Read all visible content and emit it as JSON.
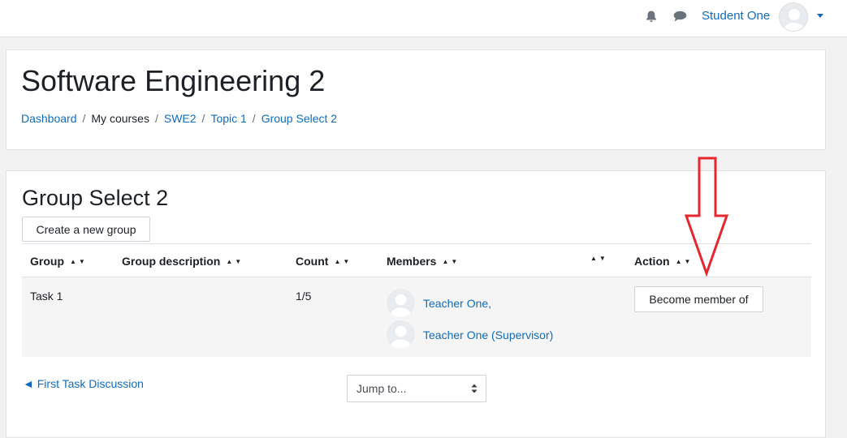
{
  "header": {
    "user_name": "Student One",
    "icons": [
      "bell-icon",
      "chat-icon",
      "avatar",
      "chevron-down-icon"
    ]
  },
  "course": {
    "title": "Software Engineering 2",
    "breadcrumb": [
      "Dashboard",
      "My courses",
      "SWE2",
      "Topic 1",
      "Group Select 2"
    ]
  },
  "main": {
    "heading": "Group Select 2",
    "create_button": "Create a new group",
    "columns": [
      "Group",
      "Group description",
      "Count",
      "Members",
      "",
      "Action"
    ],
    "rows": [
      {
        "group": "Task 1",
        "description": "",
        "count": "1/5",
        "members": [
          "Teacher One,",
          "Teacher One (Supervisor)"
        ],
        "action": "Become member of"
      }
    ]
  },
  "footer_nav": {
    "prev_link": "◄ First Task Discussion",
    "jump_placeholder": "Jump to..."
  },
  "colors": {
    "link": "#0f6cbf",
    "annotation_arrow": "#e8262f"
  }
}
